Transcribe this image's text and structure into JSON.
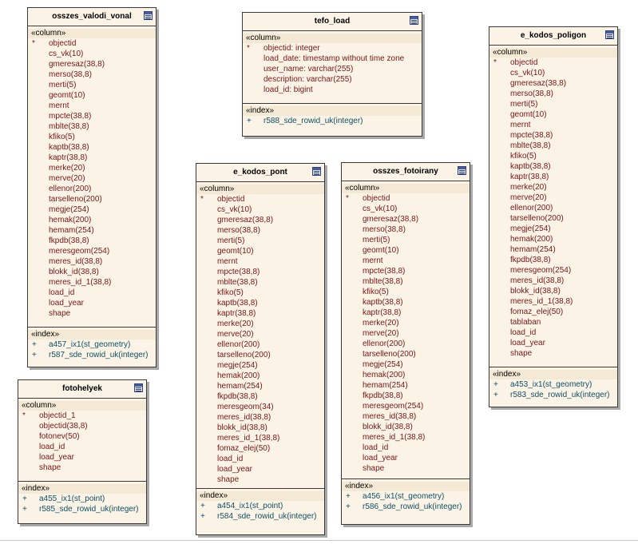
{
  "tables": [
    {
      "id": "osszes_valodi_vonal",
      "title": "osszes_valodi_vonal",
      "column_label": "«column»",
      "columns": [
        {
          "mark": "*",
          "text": "objectid"
        },
        {
          "mark": "",
          "text": "cs_vk(10)"
        },
        {
          "mark": "",
          "text": "gmeresaz(38,8)"
        },
        {
          "mark": "",
          "text": "merso(38,8)"
        },
        {
          "mark": "",
          "text": "merti(5)"
        },
        {
          "mark": "",
          "text": "geomt(10)"
        },
        {
          "mark": "",
          "text": "mernt"
        },
        {
          "mark": "",
          "text": "mpcte(38,8)"
        },
        {
          "mark": "",
          "text": "mblte(38,8)"
        },
        {
          "mark": "",
          "text": "kfiko(5)"
        },
        {
          "mark": "",
          "text": "kaptb(38,8)"
        },
        {
          "mark": "",
          "text": "kaptr(38,8)"
        },
        {
          "mark": "",
          "text": "merke(20)"
        },
        {
          "mark": "",
          "text": "merve(20)"
        },
        {
          "mark": "",
          "text": "ellenor(200)"
        },
        {
          "mark": "",
          "text": "tarselleno(200)"
        },
        {
          "mark": "",
          "text": "megje(254)"
        },
        {
          "mark": "",
          "text": "hemak(200)"
        },
        {
          "mark": "",
          "text": "hemam(254)"
        },
        {
          "mark": "",
          "text": "fkpdb(38,8)"
        },
        {
          "mark": "",
          "text": "meresgeom(254)"
        },
        {
          "mark": "",
          "text": "meres_id(38,8)"
        },
        {
          "mark": "",
          "text": "blokk_id(38,8)"
        },
        {
          "mark": "",
          "text": "meres_id_1(38,8)"
        },
        {
          "mark": "",
          "text": "load_id"
        },
        {
          "mark": "",
          "text": "load_year"
        },
        {
          "mark": "",
          "text": "shape"
        }
      ],
      "index_label": "«index»",
      "indexes": [
        {
          "mark": "+",
          "text": "a457_ix1(st_geometry)"
        },
        {
          "mark": "+",
          "text": "r587_sde_rowid_uk(integer)"
        }
      ]
    },
    {
      "id": "tefo_load",
      "title": "tefo_load",
      "column_label": "«column»",
      "columns": [
        {
          "mark": "*",
          "text": "objectid:  integer"
        },
        {
          "mark": "",
          "text": "load_date:  timestamp without time zone"
        },
        {
          "mark": "",
          "text": "user_name:  varchar(255)"
        },
        {
          "mark": "",
          "text": "description:  varchar(255)"
        },
        {
          "mark": "",
          "text": "load_id:  bigint"
        }
      ],
      "index_label": "«index»",
      "indexes": [
        {
          "mark": "+",
          "text": "r588_sde_rowid_uk(integer)"
        }
      ]
    },
    {
      "id": "e_kodos_poligon",
      "title": "e_kodos_poligon",
      "column_label": "«column»",
      "columns": [
        {
          "mark": "*",
          "text": "objectid"
        },
        {
          "mark": "",
          "text": "cs_vk(10)"
        },
        {
          "mark": "",
          "text": "gmeresaz(38,8)"
        },
        {
          "mark": "",
          "text": "merso(38,8)"
        },
        {
          "mark": "",
          "text": "merti(5)"
        },
        {
          "mark": "",
          "text": "geomt(10)"
        },
        {
          "mark": "",
          "text": "mernt"
        },
        {
          "mark": "",
          "text": "mpcte(38,8)"
        },
        {
          "mark": "",
          "text": "mblte(38,8)"
        },
        {
          "mark": "",
          "text": "kfiko(5)"
        },
        {
          "mark": "",
          "text": "kaptb(38,8)"
        },
        {
          "mark": "",
          "text": "kaptr(38,8)"
        },
        {
          "mark": "",
          "text": "merke(20)"
        },
        {
          "mark": "",
          "text": "merve(20)"
        },
        {
          "mark": "",
          "text": "ellenor(200)"
        },
        {
          "mark": "",
          "text": "tarselleno(200)"
        },
        {
          "mark": "",
          "text": "megje(254)"
        },
        {
          "mark": "",
          "text": "hemak(200)"
        },
        {
          "mark": "",
          "text": "hemam(254)"
        },
        {
          "mark": "",
          "text": "fkpdb(38,8)"
        },
        {
          "mark": "",
          "text": "meresgeom(254)"
        },
        {
          "mark": "",
          "text": "meres_id(38,8)"
        },
        {
          "mark": "",
          "text": "blokk_id(38,8)"
        },
        {
          "mark": "",
          "text": "meres_id_1(38,8)"
        },
        {
          "mark": "",
          "text": "fomaz_elej(50)"
        },
        {
          "mark": "",
          "text": "tablaban"
        },
        {
          "mark": "",
          "text": "load_id"
        },
        {
          "mark": "",
          "text": "load_year"
        },
        {
          "mark": "",
          "text": "shape"
        }
      ],
      "index_label": "«index»",
      "indexes": [
        {
          "mark": "+",
          "text": "a453_ix1(st_geometry)"
        },
        {
          "mark": "+",
          "text": "r583_sde_rowid_uk(integer)"
        }
      ]
    },
    {
      "id": "e_kodos_pont",
      "title": "e_kodos_pont",
      "column_label": "«column»",
      "columns": [
        {
          "mark": "*",
          "text": "objectid"
        },
        {
          "mark": "",
          "text": "cs_vk(10)"
        },
        {
          "mark": "",
          "text": "gmeresaz(38,8)"
        },
        {
          "mark": "",
          "text": "merso(38,8)"
        },
        {
          "mark": "",
          "text": "merti(5)"
        },
        {
          "mark": "",
          "text": "geomt(10)"
        },
        {
          "mark": "",
          "text": "mernt"
        },
        {
          "mark": "",
          "text": "mpcte(38,8)"
        },
        {
          "mark": "",
          "text": "mblte(38,8)"
        },
        {
          "mark": "",
          "text": "kfiko(5)"
        },
        {
          "mark": "",
          "text": "kaptb(38,8)"
        },
        {
          "mark": "",
          "text": "kaptr(38,8)"
        },
        {
          "mark": "",
          "text": "merke(20)"
        },
        {
          "mark": "",
          "text": "merve(20)"
        },
        {
          "mark": "",
          "text": "ellenor(200)"
        },
        {
          "mark": "",
          "text": "tarselleno(200)"
        },
        {
          "mark": "",
          "text": "megje(254)"
        },
        {
          "mark": "",
          "text": "hemak(200)"
        },
        {
          "mark": "",
          "text": "hemam(254)"
        },
        {
          "mark": "",
          "text": "fkpdb(38,8)"
        },
        {
          "mark": "",
          "text": "meresgeom(34)"
        },
        {
          "mark": "",
          "text": "meres_id(38,8)"
        },
        {
          "mark": "",
          "text": "blokk_id(38,8)"
        },
        {
          "mark": "",
          "text": "meres_id_1(38,8)"
        },
        {
          "mark": "",
          "text": "fomaz_elej(50)"
        },
        {
          "mark": "",
          "text": "load_id"
        },
        {
          "mark": "",
          "text": "load_year"
        },
        {
          "mark": "",
          "text": "shape"
        }
      ],
      "index_label": "«index»",
      "indexes": [
        {
          "mark": "+",
          "text": "a454_ix1(st_point)"
        },
        {
          "mark": "+",
          "text": "r584_sde_rowid_uk(integer)"
        }
      ]
    },
    {
      "id": "osszes_fotoirany",
      "title": "osszes_fotoirany",
      "column_label": "«column»",
      "columns": [
        {
          "mark": "*",
          "text": "objectid"
        },
        {
          "mark": "",
          "text": "cs_vk(10)"
        },
        {
          "mark": "",
          "text": "gmeresaz(38,8)"
        },
        {
          "mark": "",
          "text": "merso(38,8)"
        },
        {
          "mark": "",
          "text": "merti(5)"
        },
        {
          "mark": "",
          "text": "geomt(10)"
        },
        {
          "mark": "",
          "text": "mernt"
        },
        {
          "mark": "",
          "text": "mpcte(38,8)"
        },
        {
          "mark": "",
          "text": "mblte(38,8)"
        },
        {
          "mark": "",
          "text": "kfiko(5)"
        },
        {
          "mark": "",
          "text": "kaptb(38,8)"
        },
        {
          "mark": "",
          "text": "kaptr(38,8)"
        },
        {
          "mark": "",
          "text": "merke(20)"
        },
        {
          "mark": "",
          "text": "merve(20)"
        },
        {
          "mark": "",
          "text": "ellenor(200)"
        },
        {
          "mark": "",
          "text": "tarselleno(200)"
        },
        {
          "mark": "",
          "text": "megje(254)"
        },
        {
          "mark": "",
          "text": "hemak(200)"
        },
        {
          "mark": "",
          "text": "hemam(254)"
        },
        {
          "mark": "",
          "text": "fkpdb(38,8)"
        },
        {
          "mark": "",
          "text": "meresgeom(254)"
        },
        {
          "mark": "",
          "text": "meres_id(38,8)"
        },
        {
          "mark": "",
          "text": "blokk_id(38,8)"
        },
        {
          "mark": "",
          "text": "meres_id_1(38,8)"
        },
        {
          "mark": "",
          "text": "load_id"
        },
        {
          "mark": "",
          "text": "load_year"
        },
        {
          "mark": "",
          "text": "shape"
        }
      ],
      "index_label": "«index»",
      "indexes": [
        {
          "mark": "+",
          "text": "a456_ix1(st_geometry)"
        },
        {
          "mark": "+",
          "text": "r586_sde_rowid_uk(integer)"
        }
      ]
    },
    {
      "id": "fotohelyek",
      "title": "fotohelyek",
      "column_label": "«column»",
      "columns": [
        {
          "mark": "*",
          "text": "objectid_1"
        },
        {
          "mark": "",
          "text": "objectid(38,8)"
        },
        {
          "mark": "",
          "text": "fotonev(50)"
        },
        {
          "mark": "",
          "text": "load_id"
        },
        {
          "mark": "",
          "text": "load_year"
        },
        {
          "mark": "",
          "text": "shape"
        }
      ],
      "index_label": "«index»",
      "indexes": [
        {
          "mark": "+",
          "text": "a455_ix1(st_point)"
        },
        {
          "mark": "+",
          "text": "r585_sde_rowid_uk(integer)"
        }
      ]
    }
  ]
}
